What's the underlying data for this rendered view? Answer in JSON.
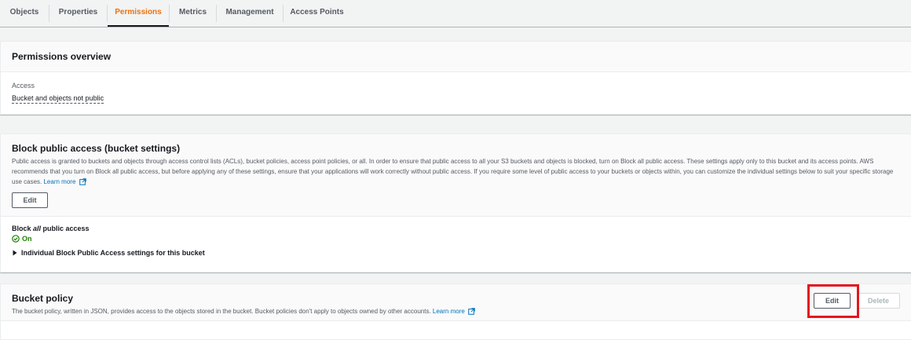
{
  "tabs": [
    {
      "label": "Objects",
      "active": false
    },
    {
      "label": "Properties",
      "active": false
    },
    {
      "label": "Permissions",
      "active": true
    },
    {
      "label": "Metrics",
      "active": false
    },
    {
      "label": "Management",
      "active": false
    },
    {
      "label": "Access Points",
      "active": false
    }
  ],
  "overview": {
    "title": "Permissions overview",
    "access_label": "Access",
    "access_value": "Bucket and objects not public"
  },
  "block_public": {
    "title": "Block public access (bucket settings)",
    "description": "Public access is granted to buckets and objects through access control lists (ACLs), bucket policies, access point policies, or all. In order to ensure that public access to all your S3 buckets and objects is blocked, turn on Block all public access. These settings apply only to this bucket and its access points. AWS recommends that you turn on Block all public access, but before applying any of these settings, ensure that your applications will work correctly without public access. If you require some level of public access to your buckets or objects within, you can customize the individual settings below to suit your specific storage use cases.",
    "learn_more": "Learn more",
    "edit_label": "Edit",
    "setting_prefix": "Block ",
    "setting_emph": "all",
    "setting_suffix": " public access",
    "status": "On",
    "expand_label": "Individual Block Public Access settings for this bucket"
  },
  "bucket_policy": {
    "title": "Bucket policy",
    "description": "The bucket policy, written in JSON, provides access to the objects stored in the bucket. Bucket policies don't apply to objects owned by other accounts.",
    "learn_more": "Learn more",
    "edit_label": "Edit",
    "delete_label": "Delete"
  },
  "colors": {
    "accent": "#ec7211",
    "link": "#0073bb",
    "success": "#1d8102",
    "highlight": "#e3161e"
  }
}
